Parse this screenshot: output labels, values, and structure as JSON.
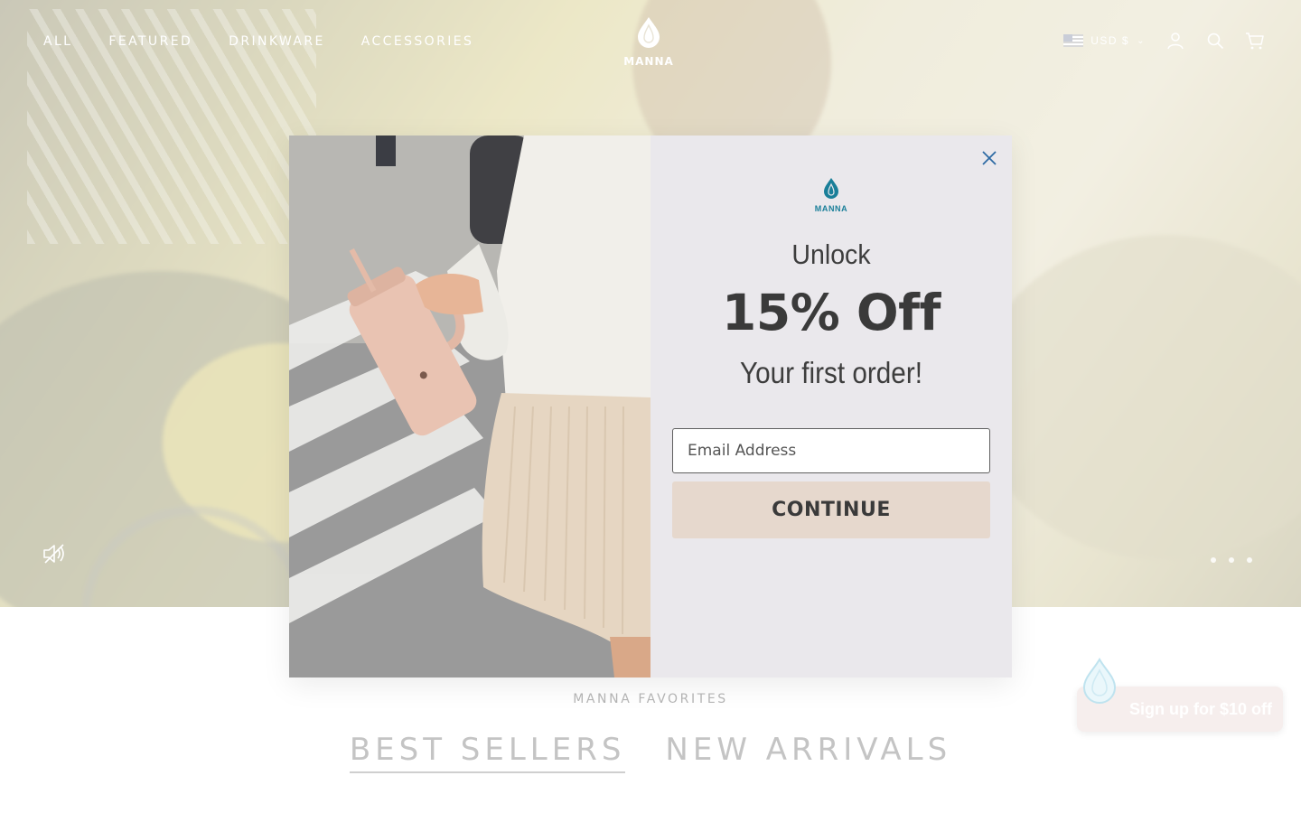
{
  "header": {
    "nav": [
      "ALL",
      "FEATURED",
      "DRINKWARE",
      "ACCESSORIES"
    ],
    "logo_text": "MANNA",
    "currency": "USD $",
    "icons": [
      "flag-icon",
      "chevron-down-icon",
      "account-icon",
      "search-icon",
      "cart-icon"
    ]
  },
  "hero": {
    "controls": [
      "mute-icon"
    ],
    "slide_count": 3
  },
  "modal": {
    "logo_text": "MANNA",
    "headline_1": "Unlock",
    "headline_2": "15% Off",
    "headline_3": "Your first order!",
    "email_placeholder": "Email Address",
    "email_value": "",
    "continue_label": "CONTINUE",
    "close_icon": "close-icon",
    "colors": {
      "accent": "#1a7f99",
      "button": "#e6d8cd",
      "panel": "#eae8ec"
    }
  },
  "section": {
    "eyebrow": "MANNA FAVORITES",
    "tabs": [
      "BEST SELLERS",
      "NEW ARRIVALS"
    ],
    "active_tab": "BEST SELLERS"
  },
  "floating": {
    "signup_label": "Sign up for $10 off",
    "icon": "water-drop-icon"
  }
}
